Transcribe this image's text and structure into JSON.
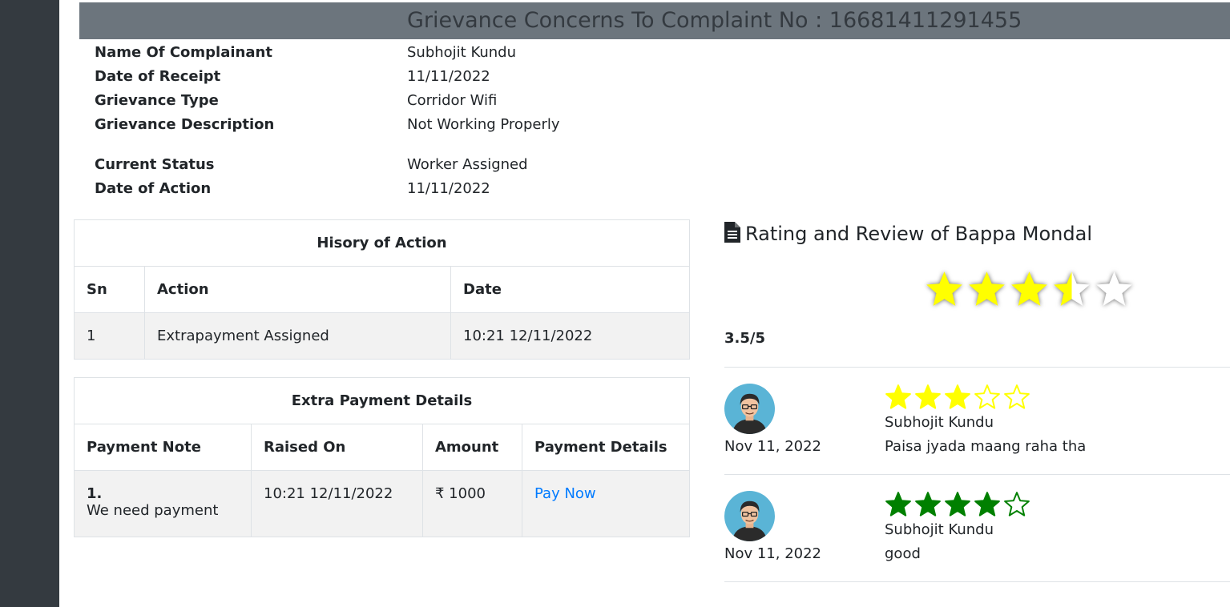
{
  "header": {
    "title": "Grievance Concerns To Complaint No : 16681411291455"
  },
  "complaint": {
    "name_label": "Name Of Complainant",
    "name_value": "Subhojit Kundu",
    "receipt_label": "Date of Receipt",
    "receipt_value": "11/11/2022",
    "type_label": "Grievance Type",
    "type_value": "Corridor Wifi",
    "desc_label": "Grievance Description",
    "desc_value": "Not Working Properly",
    "status_label": "Current Status",
    "status_value": "Worker Assigned",
    "action_label": "Date of Action",
    "action_value": "11/11/2022"
  },
  "history": {
    "caption": "Hisory of Action",
    "columns": [
      "Sn",
      "Action",
      "Date"
    ],
    "rows": [
      {
        "sn": "1",
        "action": "Extrapayment Assigned",
        "date": "10:21 12/11/2022"
      }
    ]
  },
  "extra_payment": {
    "caption": "Extra Payment Details",
    "columns": [
      "Payment Note",
      "Raised On",
      "Amount",
      "Payment Details"
    ],
    "rows": [
      {
        "num": "1.",
        "note": "We need payment",
        "raised_on": "10:21 12/11/2022",
        "amount": "₹ 1000",
        "link": "Pay Now"
      }
    ]
  },
  "rating": {
    "title": "Rating and Review of Bappa Mondal",
    "score_text": "3.5/5",
    "average": 3.5,
    "max": 5,
    "icon": "file-text-icon",
    "star_fill_color": "#ffff00",
    "star_empty_color": "#ffffff"
  },
  "reviews": [
    {
      "date": "Nov 11, 2022",
      "name": "Subhojit Kundu",
      "text": "Paisa jyada maang raha tha",
      "stars": 3,
      "star_color": "#ffff00",
      "avatar": "user-avatar-icon"
    },
    {
      "date": "Nov 11, 2022",
      "name": "Subhojit Kundu",
      "text": "good",
      "stars": 4,
      "star_color": "#008000",
      "avatar": "user-avatar-icon"
    }
  ],
  "colors": {
    "sidebar": "#343a40",
    "header_bg": "#6c757d",
    "link": "#007bff"
  }
}
